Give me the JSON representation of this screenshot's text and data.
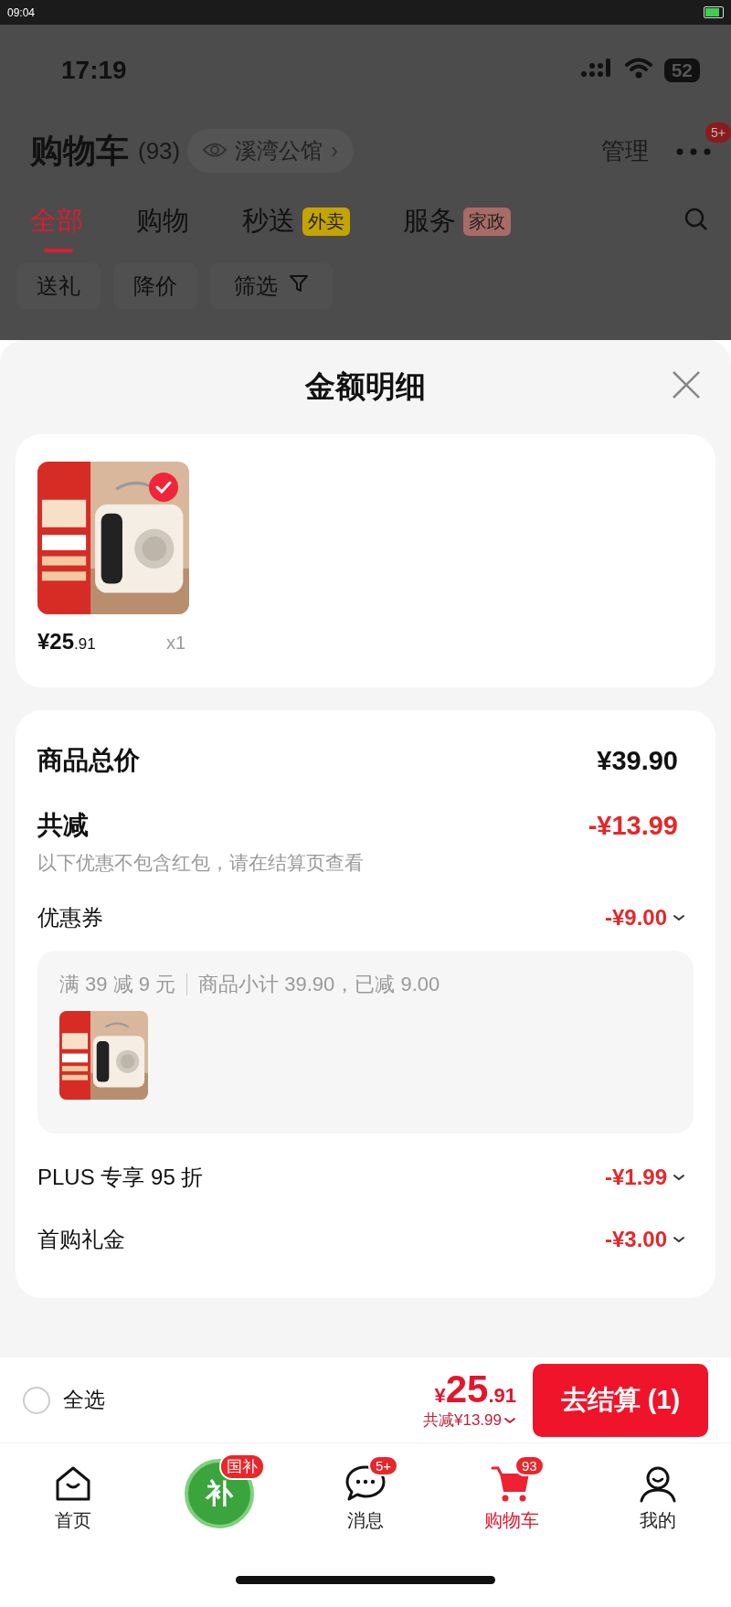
{
  "system_bar": {
    "time": "09:04"
  },
  "background_page": {
    "status_bar": {
      "time": "17:19",
      "battery": "52"
    },
    "header": {
      "title": "购物车",
      "count": "(93)",
      "location": "溪湾公馆",
      "manage": "管理",
      "more_badge": "5+"
    },
    "tabs": [
      {
        "label": "全部",
        "selected": true
      },
      {
        "label": "购物",
        "selected": false
      },
      {
        "label": "秒送",
        "selected": false,
        "tag": "外卖",
        "color": "#c4a400"
      },
      {
        "label": "服务",
        "selected": false,
        "tag": "家政",
        "color": "#a86b66"
      }
    ],
    "chips": [
      {
        "label": "送礼",
        "kind": "plain"
      },
      {
        "label": "降价",
        "kind": "plain"
      },
      {
        "label": "筛选",
        "kind": "filter"
      }
    ]
  },
  "sheet": {
    "title": "金额明细",
    "product": {
      "price_main": "¥25",
      "price_cents": ".91",
      "quantity": "x1",
      "checked": true
    },
    "total": {
      "label": "商品总价",
      "value": "¥39.90"
    },
    "reduction": {
      "label": "共减",
      "value": "-¥13.99",
      "note": "以下优惠不包含红包，请在结算页查看"
    },
    "discounts": [
      {
        "label": "优惠券",
        "value": "-¥9.00",
        "rule": "满 39 减 9 元",
        "detail": "商品小计 39.90，已减 9.00"
      },
      {
        "label": "PLUS 专享 95 折",
        "value": "-¥1.99"
      },
      {
        "label": "首购礼金",
        "value": "-¥3.00"
      }
    ]
  },
  "checkout": {
    "select_all": {
      "label": "全选",
      "checked": false
    },
    "currency": "¥",
    "price_main": "25",
    "price_cents": ".91",
    "saving": "共减¥13.99",
    "button": "去结算 (1)"
  },
  "tab_bar": [
    {
      "kind": "home",
      "label": "首页",
      "selected": false
    },
    {
      "kind": "subsidy",
      "logo_text": "补",
      "badge": "国补",
      "selected": false
    },
    {
      "kind": "messages",
      "label": "消息",
      "badge": "5+",
      "selected": false
    },
    {
      "kind": "cart",
      "label": "购物车",
      "badge": "93",
      "selected": true
    },
    {
      "kind": "profile",
      "label": "我的",
      "selected": false
    }
  ]
}
